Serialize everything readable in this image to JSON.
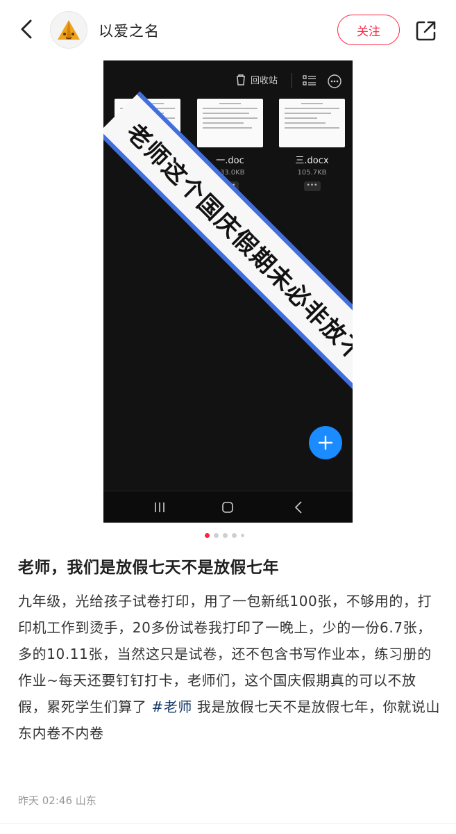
{
  "header": {
    "back_icon": "chevron-left-icon",
    "username": "以爱之名",
    "follow_label": "关注",
    "share_icon": "share-external-icon"
  },
  "post_image": {
    "recycle_label": "回收站",
    "files": [
      {
        "name": "",
        "size": ""
      },
      {
        "name": "一.doc",
        "size": "133.0KB"
      },
      {
        "name": "三.docx",
        "size": "105.7KB"
      }
    ],
    "banner_text": "老师这个国庆假期未必非放不可",
    "colors": {
      "background": "#121212",
      "banner_border": "#3f6fe0",
      "fab": "#1a8cff"
    }
  },
  "pager": {
    "total": 5,
    "active": 0
  },
  "post": {
    "title": "老师，我们是放假七天不是放假七年",
    "content_before": "九年级，光给孩子试卷打印，用了一包新纸100张，不够用的，打印机工作到烫手，20多份试卷我打印了一晚上，少的一份6.7张，多的10.11张，当然这只是试卷，还不包含书写作业本，练习册的作业~每天还要钉钉打卡，老师们，这个国庆假期真的可以不放假，累死学生们算了 ",
    "hashtag": "#老师",
    "content_after": " 我是放假七天不是放假七年，你就说山东内卷不内卷",
    "meta": "昨天 02:46 山东"
  },
  "colors": {
    "accent": "#ff2442",
    "hashtag": "#133667"
  }
}
